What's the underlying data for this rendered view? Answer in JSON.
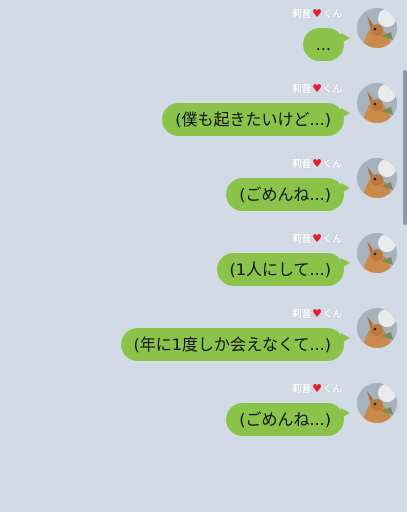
{
  "messages": [
    {
      "sender_name": "莉音",
      "sender_heart": "♥",
      "sender_suffix": "くん",
      "text": "..."
    },
    {
      "sender_name": "莉音",
      "sender_heart": "♥",
      "sender_suffix": "くん",
      "text": "(僕も起きたいけど...)"
    },
    {
      "sender_name": "莉音",
      "sender_heart": "♥",
      "sender_suffix": "くん",
      "text": "(ごめんね...)"
    },
    {
      "sender_name": "莉音",
      "sender_heart": "♥",
      "sender_suffix": "くん",
      "text": "(1人にして...)"
    },
    {
      "sender_name": "莉音",
      "sender_heart": "♥",
      "sender_suffix": "くん",
      "text": "(年に1度しか会えなくて...)"
    },
    {
      "sender_name": "莉音",
      "sender_heart": "♥",
      "sender_suffix": "くん",
      "text": "(ごめんね...)"
    }
  ],
  "colors": {
    "background": "#d1dae5",
    "bubble": "#8ac34a",
    "heart": "#e0212a"
  }
}
